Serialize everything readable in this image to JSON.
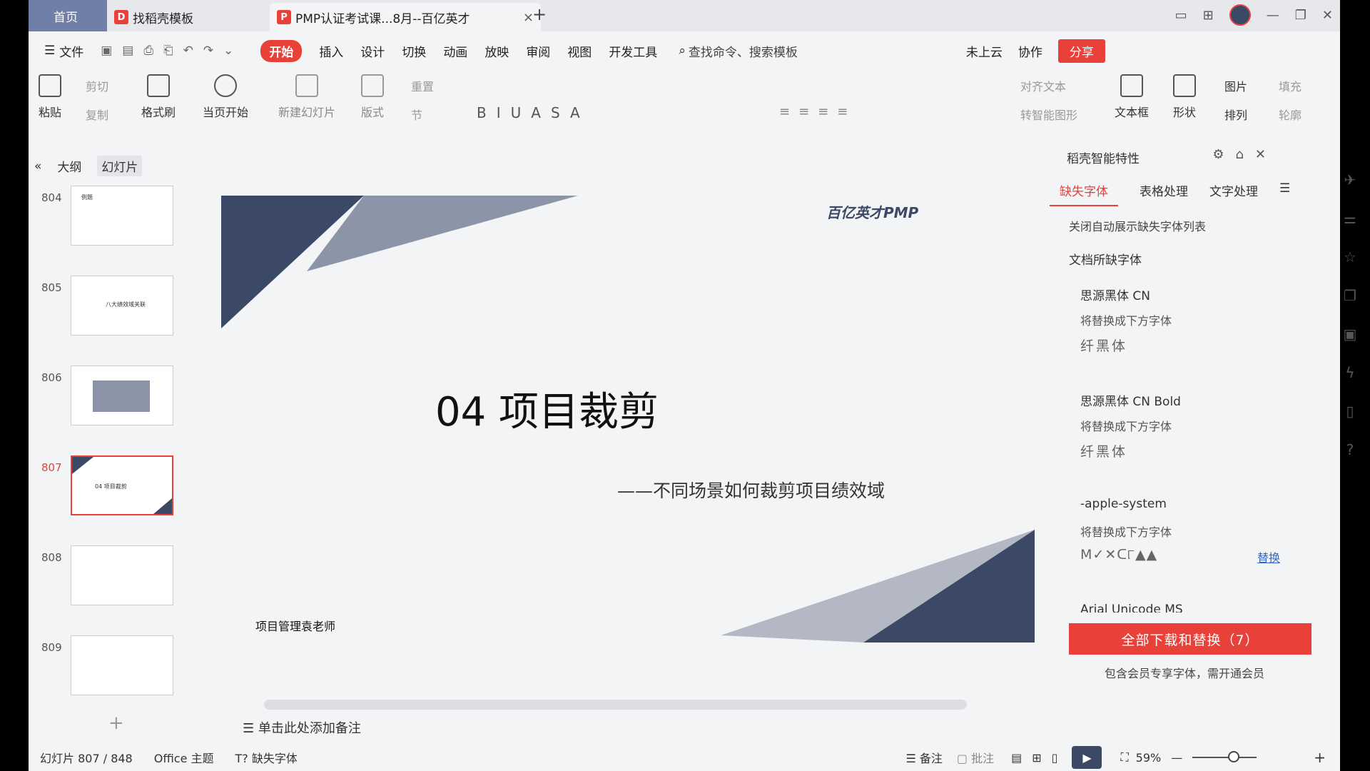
{
  "tabs": {
    "home": "首页",
    "templates": "找稻壳模板",
    "document": "PMP认证考试课...8月--百亿英才",
    "close": "×",
    "new": "+"
  },
  "menu": {
    "file": "文件",
    "items": [
      "开始",
      "插入",
      "设计",
      "切换",
      "动画",
      "放映",
      "审阅",
      "视图",
      "开发工具"
    ],
    "search": "查找命令、搜索模板",
    "cloud": "未上云",
    "collab": "协作",
    "share": "分享"
  },
  "ribbon": {
    "paste": "粘贴",
    "cut": "剪切",
    "copy": "复制",
    "format_painter": "格式刷",
    "start_from_current": "当页开始",
    "new_slide": "新建幻灯片",
    "layout": "版式",
    "section": "节",
    "reset": "重置",
    "align_text": "对齐文本",
    "smart_shape": "转智能图形",
    "textbox": "文本框",
    "shape": "形状",
    "picture": "图片",
    "arrange": "排列",
    "outline_btn": "轮廓",
    "fill": "填充"
  },
  "left_panel": {
    "outline_tab": "大纲",
    "slides_tab": "幻灯片",
    "thumbs": [
      {
        "num": "804",
        "text": "例题"
      },
      {
        "num": "805",
        "text": "八大绩效域关联"
      },
      {
        "num": "806",
        "text": ""
      },
      {
        "num": "807",
        "text": "04  项目裁剪"
      },
      {
        "num": "808",
        "text": ""
      },
      {
        "num": "809",
        "text": ""
      }
    ]
  },
  "slide": {
    "title": "04   项目裁剪",
    "subtitle": "——不同场景如何裁剪项目绩效域",
    "teacher": "项目管理袁老师",
    "logo": "百亿英才PMP"
  },
  "notes": "单击此处添加备注",
  "right_panel": {
    "title": "稻壳智能特性",
    "tabs": [
      "缺失字体",
      "表格处理",
      "文字处理"
    ],
    "close_auto": "关闭自动展示缺失字体列表",
    "doc_missing": "文档所缺字体",
    "fonts": [
      {
        "name": "思源黑体 CN",
        "replace_label": "将替换成下方字体",
        "alt": "纤黑体"
      },
      {
        "name": "思源黑体 CN Bold",
        "replace_label": "将替换成下方字体",
        "alt": "纤黑体"
      },
      {
        "name": "-apple-system",
        "replace_label": "将替换成下方字体",
        "alt": "M✓✕ᑕ୮▲▲",
        "action": "替换"
      },
      {
        "name": "Arial Unicode MS"
      }
    ],
    "download_all": "全部下载和替换（7）",
    "member_note": "包含会员专享字体，需开通会员"
  },
  "status": {
    "slide_pos": "幻灯片 807 / 848",
    "theme": "Office 主题",
    "missing_font": "缺失字体",
    "notes": "备注",
    "comments": "批注",
    "zoom": "59%"
  }
}
